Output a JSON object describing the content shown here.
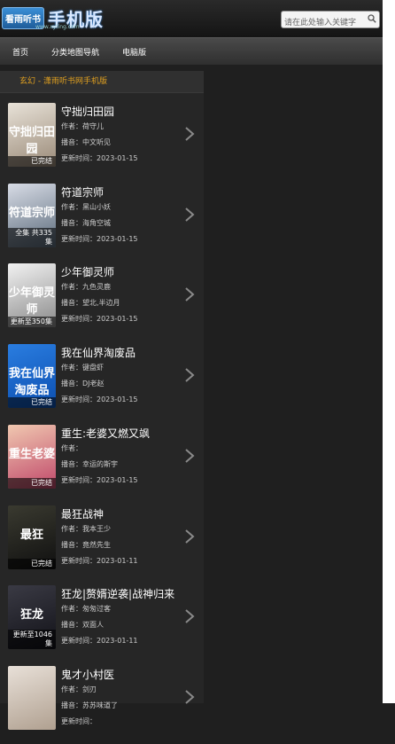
{
  "header": {
    "logo_badge": "看雨听书",
    "logo_text": "手机版",
    "logo_url": "www.xyting.com"
  },
  "search": {
    "placeholder": "请在此处输入关键字"
  },
  "nav": {
    "items": [
      "首页",
      "分类地图导航",
      "电脑版"
    ]
  },
  "panel": {
    "title": "玄幻 - 潇雨听书网手机版"
  },
  "labels": {
    "author": "作者：",
    "narrator": "播音：",
    "updated": "更新时间："
  },
  "books": [
    {
      "title": "守拙归田园",
      "author": "荷守儿",
      "narrator": "中文听见",
      "updated": "2023-01-15",
      "badge": "已完结",
      "cover_text": "守拙归田园",
      "color1": "#e8e2d8",
      "color2": "#9a8a78"
    },
    {
      "title": "符道宗师",
      "author": "黑山小妖",
      "narrator": "海角空城",
      "updated": "2023-01-15",
      "badge": "全集 共335集",
      "cover_text": "符道宗师",
      "color1": "#d8dce6",
      "color2": "#5a6a7a"
    },
    {
      "title": "少年御灵师",
      "author": "九色灵鹿",
      "narrator": "望北,半边月",
      "updated": "2023-01-15",
      "badge": "更新至350集",
      "cover_text": "少年御灵师",
      "color1": "#f2f2f2",
      "color2": "#8a8a8a"
    },
    {
      "title": "我在仙界淘废品",
      "author": "键盘虾",
      "narrator": "DJ老赵",
      "updated": "2023-01-15",
      "badge": "已完结",
      "cover_text": "我在仙界淘废品",
      "color1": "#2a7de0",
      "color2": "#0c4fb0"
    },
    {
      "title": "重生:老婆又燃又飒",
      "author": "",
      "narrator": "幸运的斯宇",
      "updated": "2023-01-15",
      "badge": "已完结",
      "cover_text": "重生老婆",
      "color1": "#f0c8b0",
      "color2": "#c0486a"
    },
    {
      "title": "最狂战神",
      "author": "我本王少",
      "narrator": "竟然先生",
      "updated": "2023-01-11",
      "badge": "已完结",
      "cover_text": "最狂",
      "color1": "#3a3a30",
      "color2": "#101010"
    },
    {
      "title": "狂龙|赘婿逆袭|战神归来",
      "author": "匆匆过客",
      "narrator": "双面人",
      "updated": "2023-01-11",
      "badge": "更新至1046集",
      "cover_text": "狂龙",
      "color1": "#3a3a44",
      "color2": "#121218"
    },
    {
      "title": "鬼才小村医",
      "author": "剑刃",
      "narrator": "苏苏味道了",
      "updated": "",
      "badge": "",
      "cover_text": "",
      "color1": "#e8e0d8",
      "color2": "#b0a090"
    }
  ]
}
